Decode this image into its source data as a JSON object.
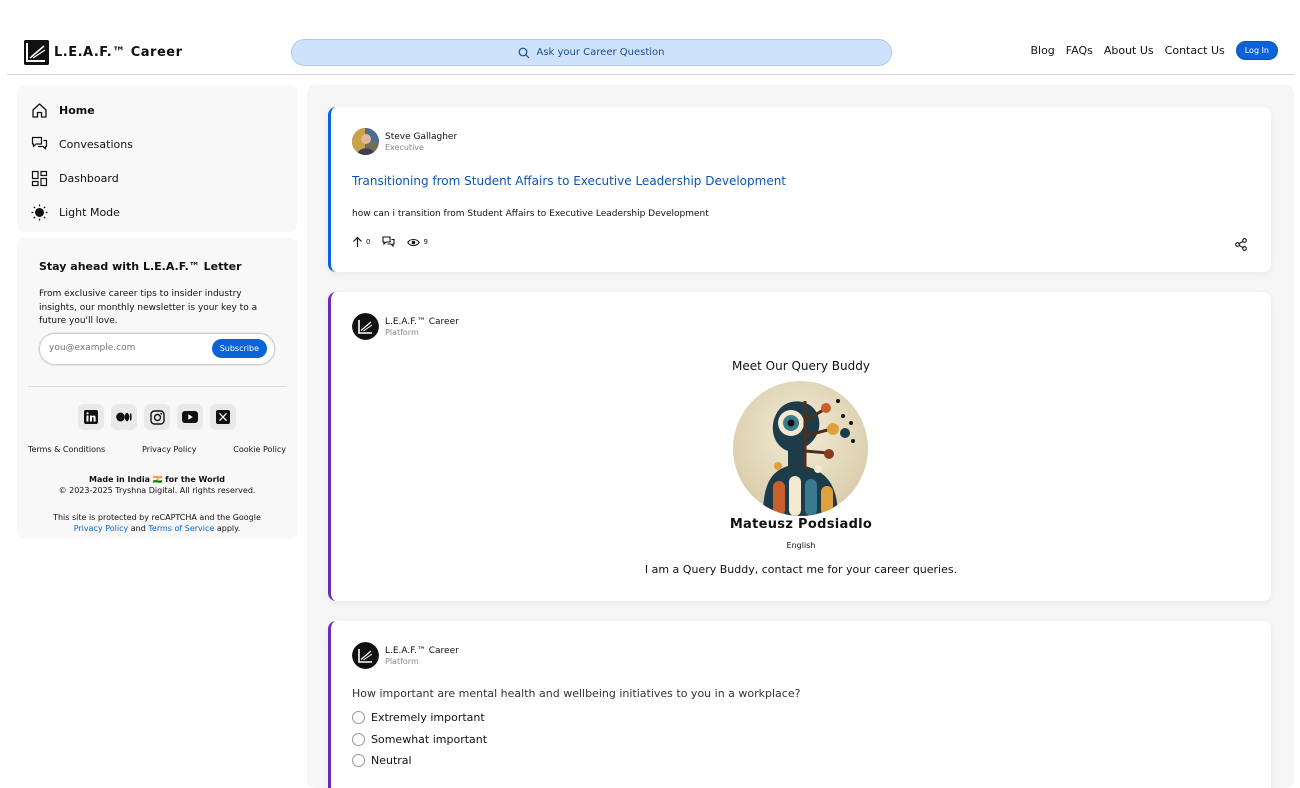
{
  "header": {
    "brand": "L.E.A.F.™ Career",
    "search_placeholder": "Ask your Career Question",
    "nav": [
      "Blog",
      "FAQs",
      "About Us",
      "Contact Us"
    ],
    "login_label": "Log In"
  },
  "sidebar": {
    "items": [
      {
        "label": "Home",
        "icon": "home-icon"
      },
      {
        "label": "Convesations",
        "icon": "chat-icon"
      },
      {
        "label": "Dashboard",
        "icon": "dashboard-icon"
      },
      {
        "label": "Light Mode",
        "icon": "sun-icon"
      }
    ]
  },
  "newsletter": {
    "title": "Stay ahead with L.E.A.F.™ Letter",
    "text": "From exclusive career tips to insider industry insights, our monthly newsletter is your key to a future you'll love.",
    "email_placeholder": "you@example.com",
    "subscribe_label": "Subscribe"
  },
  "socials": [
    "linkedin-icon",
    "medium-icon",
    "instagram-icon",
    "youtube-icon",
    "x-icon"
  ],
  "footer": {
    "links": [
      "Terms & Conditions",
      "Privacy Policy",
      "Cookie Policy"
    ],
    "made_in_bold_1": "Made in India",
    "made_in_flag": "🇮🇳",
    "made_in_bold_2": "for the World",
    "copyright": "© 2023-2025 Tryshna Digital. All rights reserved.",
    "recaptcha_pre": "This site is protected by reCAPTCHA and the Google",
    "recaptcha_privacy": "Privacy Policy",
    "recaptcha_and": "and",
    "recaptcha_terms": "Terms of Service",
    "recaptcha_post": "apply."
  },
  "feed": {
    "post": {
      "author": "Steve Gallagher",
      "role": "Executive",
      "title": "Transitioning from Student Affairs to Executive Leadership Development",
      "body": "how can i transition from Student Affairs to Executive Leadership Development",
      "upvotes": "0",
      "views": "9"
    },
    "query_buddy": {
      "author": "L.E.A.F.™ Career",
      "role": "Platform",
      "title": "Meet Our Query Buddy",
      "name": "Mateusz Podsiadlo",
      "language": "English",
      "description": "I am a Query Buddy, contact me for your career queries."
    },
    "poll": {
      "author": "L.E.A.F.™ Career",
      "role": "Platform",
      "question": "How important are mental health and wellbeing initiatives to you in a workplace?",
      "options": [
        "Extremely important",
        "Somewhat important",
        "Neutral"
      ]
    }
  }
}
